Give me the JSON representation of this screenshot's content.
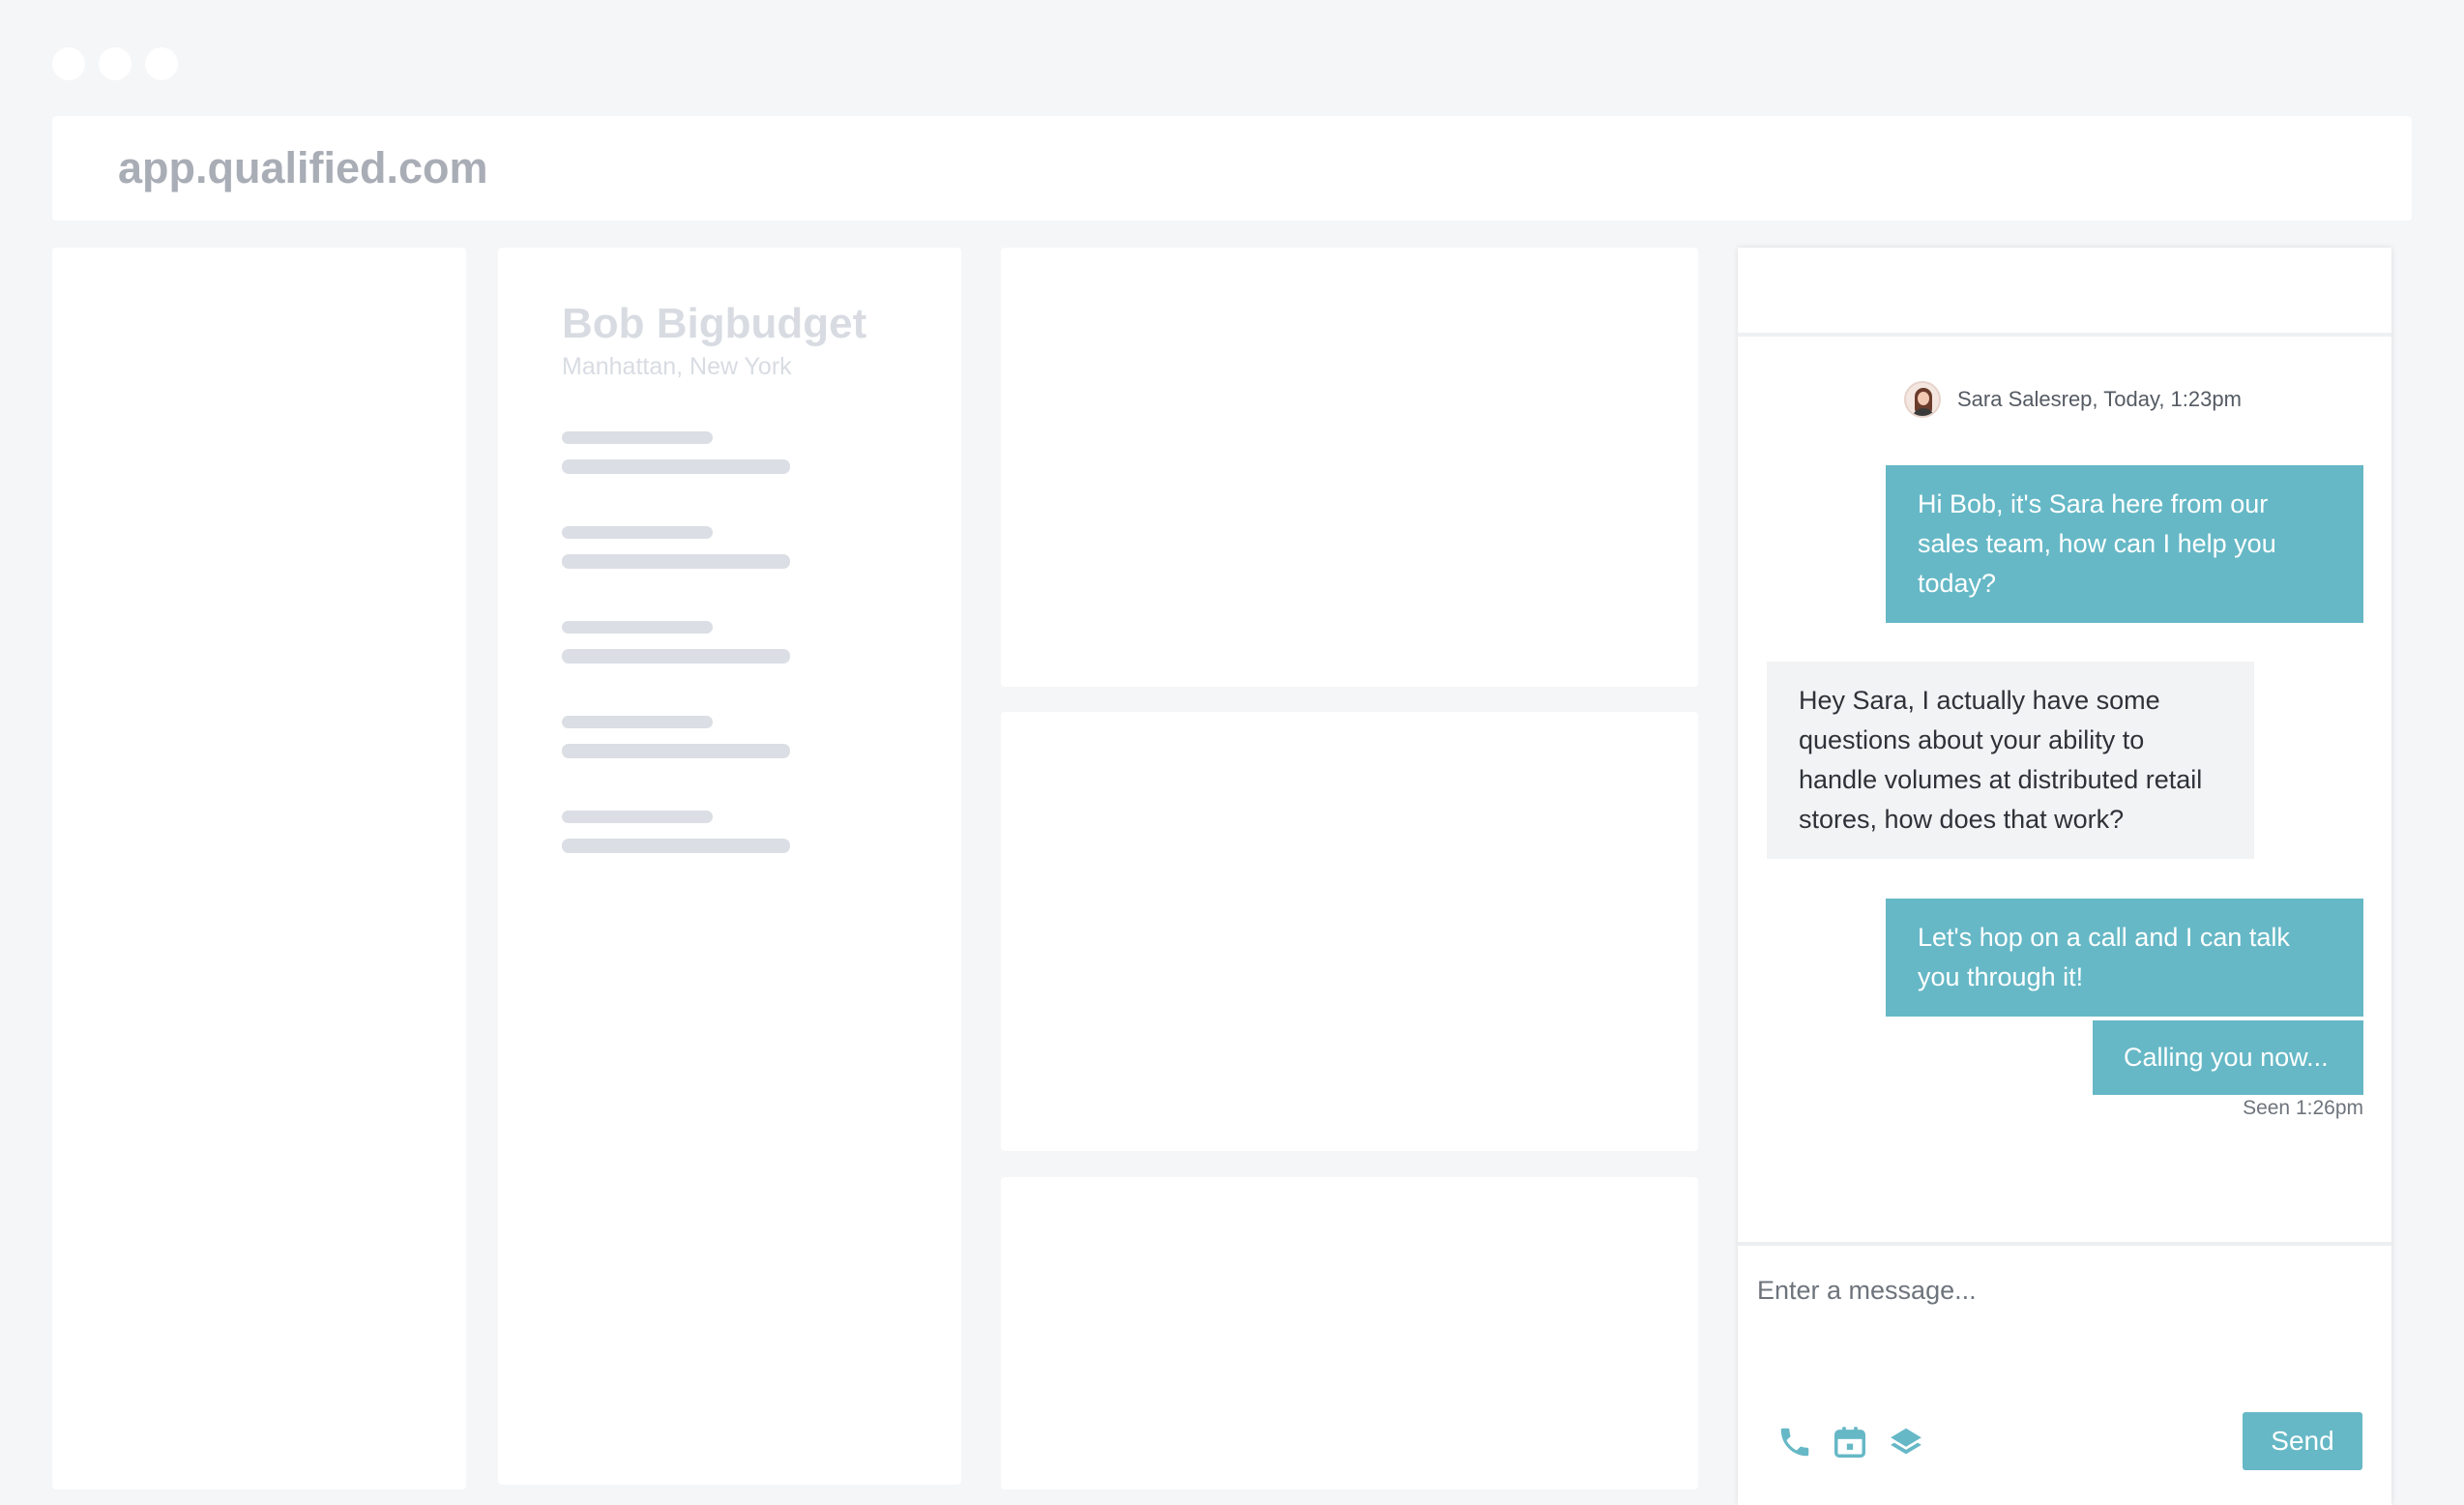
{
  "browser": {
    "url": "app.qualified.com"
  },
  "contact": {
    "name": "Bob Bigbudget",
    "location": "Manhattan, New York"
  },
  "chat": {
    "sender_line": "Sara Salesrep, Today, 1:23pm",
    "messages": [
      {
        "from": "agent",
        "text": "Hi Bob, it's Sara here from our sales team, how can I help you today?"
      },
      {
        "from": "visitor",
        "text": "Hey Sara, I actually have some questions about your ability to handle volumes at distributed retail stores, how does that work?"
      },
      {
        "from": "agent",
        "text": "Let's hop on a call and I can talk you through it!"
      },
      {
        "from": "agent",
        "text": "Calling you now..."
      }
    ],
    "seen": "Seen 1:26pm",
    "input_placeholder": "Enter a message...",
    "send_label": "Send",
    "tools": [
      "phone-icon",
      "calendar-icon",
      "layers-icon"
    ]
  },
  "colors": {
    "accent": "#66b8c6",
    "background": "#f5f6f8",
    "skeleton": "#dbdee4"
  }
}
